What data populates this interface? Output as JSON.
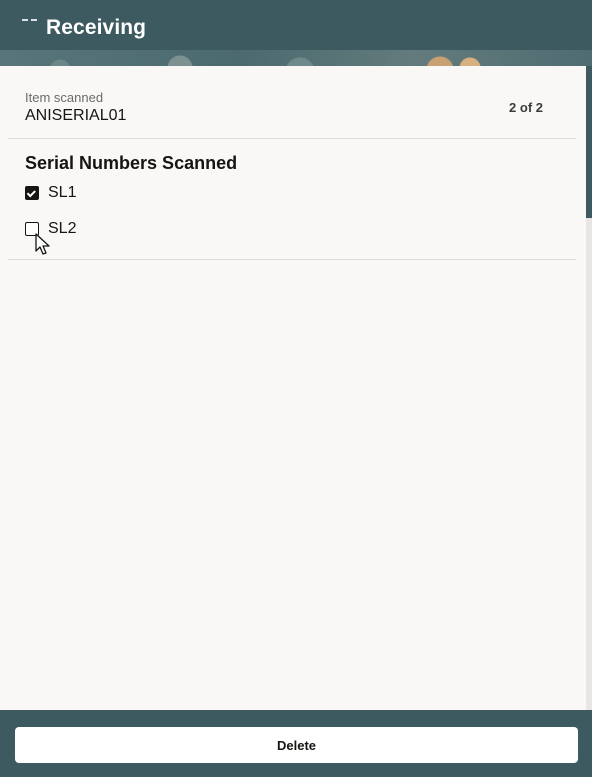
{
  "header": {
    "title": "Receiving",
    "menu_icon": "menu-icon"
  },
  "item": {
    "label": "Item scanned",
    "value": "ANISERIAL01",
    "pager": "2 of 2"
  },
  "serials": {
    "title": "Serial Numbers Scanned",
    "items": [
      {
        "label": "SL1",
        "checked": true
      },
      {
        "label": "SL2",
        "checked": false
      }
    ]
  },
  "footer": {
    "delete_label": "Delete"
  },
  "colors": {
    "header_bg": "#3d5a61",
    "content_bg": "#f9f8f7",
    "text": "#161513"
  }
}
